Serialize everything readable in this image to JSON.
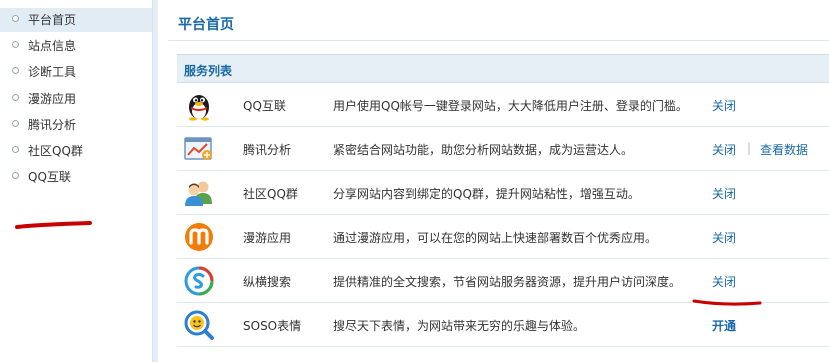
{
  "sidebar": {
    "items": [
      {
        "label": "平台首页",
        "active": true
      },
      {
        "label": "站点信息"
      },
      {
        "label": "诊断工具"
      },
      {
        "label": "漫游应用"
      },
      {
        "label": "腾讯分析"
      },
      {
        "label": "社区QQ群"
      },
      {
        "label": "QQ互联"
      }
    ]
  },
  "main": {
    "title": "平台首页",
    "panel_title": "服务列表",
    "services": [
      {
        "name": "QQ互联",
        "desc": "用户使用QQ帐号一键登录网站，大大降低用户注册、登录的门槛。",
        "action": "关闭",
        "icon": "qq-penguin-icon"
      },
      {
        "name": "腾讯分析",
        "desc": "紧密结合网站功能，助您分析网站数据，成为运营达人。",
        "action": "关闭",
        "extra": "查看数据",
        "icon": "analytics-chart-icon"
      },
      {
        "name": "社区QQ群",
        "desc": "分享网站内容到绑定的QQ群，提升网站粘性，增强互动。",
        "action": "关闭",
        "icon": "users-group-icon"
      },
      {
        "name": "漫游应用",
        "desc": "通过漫游应用，可以在您的网站上快速部署数百个优秀应用。",
        "action": "关闭",
        "icon": "manyou-m-icon"
      },
      {
        "name": "纵横搜索",
        "desc": "提供精准的全文搜索，节省网站服务器资源，提升用户访问深度。",
        "action": "关闭",
        "icon": "soso-search-icon"
      },
      {
        "name": "SOSO表情",
        "desc": "搜尽天下表情，为网站带来无穷的乐趣与体验。",
        "action": "开通",
        "icon": "soso-emoticon-icon"
      }
    ]
  },
  "colors": {
    "accent": "#1a6aa5",
    "annotation": "#c80000",
    "panel_header": "#e6eff6"
  }
}
